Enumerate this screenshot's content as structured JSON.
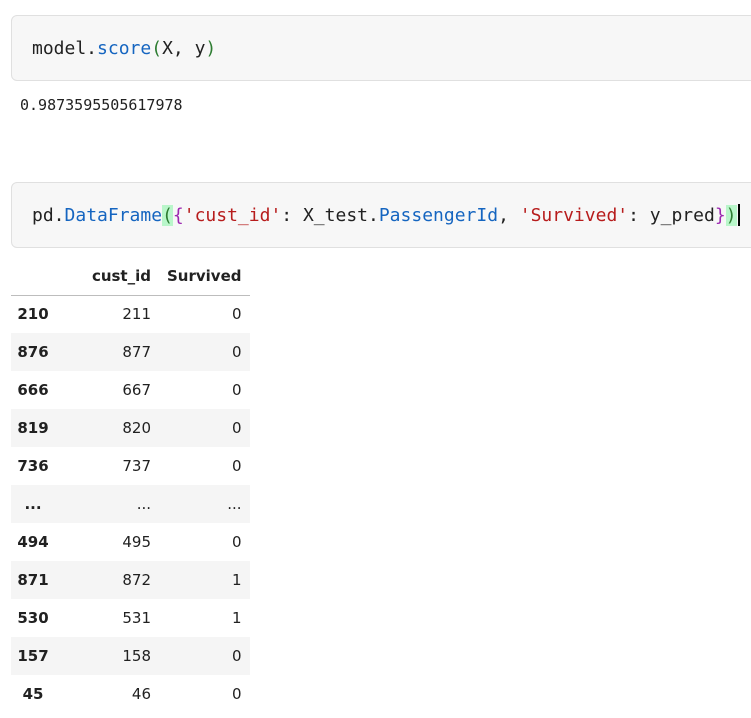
{
  "cell1": {
    "tokens": {
      "obj": "model.",
      "fn": "score",
      "open": "(",
      "args": "X, y",
      "close": ")"
    }
  },
  "output1": {
    "text": "0.9873595505617978"
  },
  "cell2": {
    "tokens": {
      "mod": "pd.",
      "fn": "DataFrame",
      "open_paren": "(",
      "open_brace": "{",
      "key1": "'cust_id'",
      "colon1": ": X_test.",
      "attr": "PassengerId",
      "comma": ", ",
      "key2": "'Survived'",
      "colon2": ": y_pred",
      "close_brace": "}",
      "close_paren": ")"
    }
  },
  "dataframe": {
    "columns": [
      "cust_id",
      "Survived"
    ],
    "rows": [
      {
        "index": "210",
        "cust_id": "211",
        "survived": "0"
      },
      {
        "index": "876",
        "cust_id": "877",
        "survived": "0"
      },
      {
        "index": "666",
        "cust_id": "667",
        "survived": "0"
      },
      {
        "index": "819",
        "cust_id": "820",
        "survived": "0"
      },
      {
        "index": "736",
        "cust_id": "737",
        "survived": "0"
      },
      {
        "index": "...",
        "cust_id": "...",
        "survived": "..."
      },
      {
        "index": "494",
        "cust_id": "495",
        "survived": "0"
      },
      {
        "index": "871",
        "cust_id": "872",
        "survived": "1"
      },
      {
        "index": "530",
        "cust_id": "531",
        "survived": "1"
      },
      {
        "index": "157",
        "cust_id": "158",
        "survived": "0"
      },
      {
        "index": "45",
        "cust_id": "46",
        "survived": "0"
      }
    ]
  }
}
